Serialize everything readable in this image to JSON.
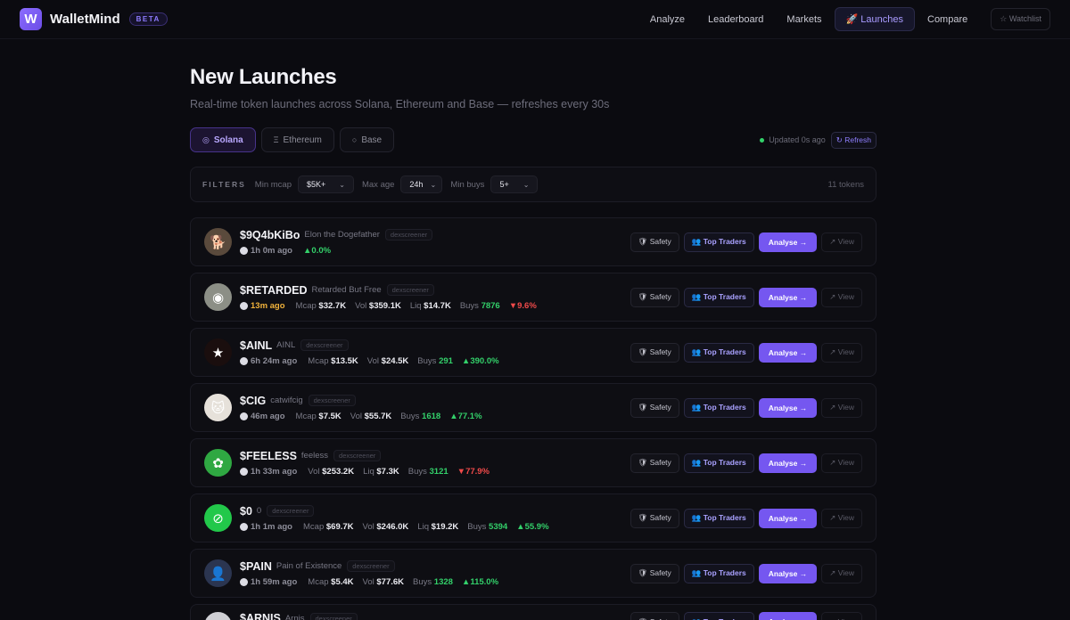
{
  "app": {
    "name": "WalletMind",
    "badge": "BETA",
    "logo_letter": "W"
  },
  "nav": {
    "items": [
      {
        "label": "Analyze"
      },
      {
        "label": "Leaderboard"
      },
      {
        "label": "Markets"
      },
      {
        "label": "🚀 Launches",
        "active": true
      },
      {
        "label": "Compare"
      }
    ],
    "watchlist": "☆ Watchlist"
  },
  "page": {
    "title": "New Launches",
    "subtitle": "Real-time token launches across Solana, Ethereum and Base — refreshes every 30s"
  },
  "chains": [
    {
      "label": "Solana",
      "glyph": "◎",
      "active": true
    },
    {
      "label": "Ethereum",
      "glyph": "Ξ",
      "active": false
    },
    {
      "label": "Base",
      "glyph": "○",
      "active": false
    }
  ],
  "status": {
    "updated": "Updated 0s ago",
    "refresh": "↻ Refresh"
  },
  "filters": {
    "title": "FILTERS",
    "min_mcap": {
      "label": "Min mcap",
      "value": "$5K+"
    },
    "max_age": {
      "label": "Max age",
      "value": "24h"
    },
    "min_buys": {
      "label": "Min buys",
      "value": "5+"
    },
    "count": "11 tokens"
  },
  "actions": {
    "safety": "🛡 Safety",
    "top_traders": "👥 Top Traders",
    "analyse": "Analyse →",
    "view": "↗ View"
  },
  "tokens": [
    {
      "symbol": "$9Q4bKiBo",
      "name": "Elon the Dogefather",
      "dex": "dexscreener",
      "age": "1h 0m ago",
      "fresh": false,
      "mcap": "",
      "vol": "",
      "liq": "",
      "buys": "",
      "change": "0.0%",
      "dir": "up",
      "avatar_color": "#5a4a3c",
      "avatar_glyph": "🐕"
    },
    {
      "symbol": "$RETARDED",
      "name": "Retarded But Free",
      "dex": "dexscreener",
      "age": "13m ago",
      "fresh": true,
      "mcap": "$32.7K",
      "vol": "$359.1K",
      "liq": "$14.7K",
      "buys": "7876",
      "change": "9.6%",
      "dir": "down",
      "avatar_color": "#8c8f86",
      "avatar_glyph": "◉"
    },
    {
      "symbol": "$AINL",
      "name": "AINL",
      "dex": "dexscreener",
      "age": "6h 24m ago",
      "fresh": false,
      "mcap": "$13.5K",
      "vol": "$24.5K",
      "liq": "",
      "buys": "291",
      "change": "390.0%",
      "dir": "up",
      "avatar_color": "#1a0e0e",
      "avatar_glyph": "★"
    },
    {
      "symbol": "$CIG",
      "name": "catwifcig",
      "dex": "dexscreener",
      "age": "46m ago",
      "fresh": false,
      "mcap": "$7.5K",
      "vol": "$55.7K",
      "liq": "",
      "buys": "1618",
      "change": "77.1%",
      "dir": "up",
      "avatar_color": "#e6e1da",
      "avatar_glyph": "🐱"
    },
    {
      "symbol": "$FEELESS",
      "name": "feeless",
      "dex": "dexscreener",
      "age": "1h 33m ago",
      "fresh": false,
      "mcap": "",
      "vol": "$253.2K",
      "liq": "$7.3K",
      "buys": "3121",
      "change": "77.9%",
      "dir": "down",
      "avatar_color": "#2fa842",
      "avatar_glyph": "✿"
    },
    {
      "symbol": "$0",
      "name": "0",
      "dex": "dexscreener",
      "age": "1h 1m ago",
      "fresh": false,
      "mcap": "$69.7K",
      "vol": "$246.0K",
      "liq": "$19.2K",
      "buys": "5394",
      "change": "55.9%",
      "dir": "up",
      "avatar_color": "#22c84a",
      "avatar_glyph": "⊘"
    },
    {
      "symbol": "$PAIN",
      "name": "Pain of Existence",
      "dex": "dexscreener",
      "age": "1h 59m ago",
      "fresh": false,
      "mcap": "$5.4K",
      "vol": "$77.6K",
      "liq": "",
      "buys": "1328",
      "change": "115.0%",
      "dir": "up",
      "avatar_color": "#2b3550",
      "avatar_glyph": "👤"
    },
    {
      "symbol": "$ARNIS",
      "name": "Arnis",
      "dex": "dexscreener",
      "age": "",
      "fresh": false,
      "mcap": "",
      "vol": "",
      "liq": "",
      "buys": "",
      "change": "",
      "dir": "up",
      "avatar_color": "#cfcfd4",
      "avatar_glyph": ""
    }
  ],
  "labels": {
    "mcap": "Mcap",
    "vol": "Vol",
    "liq": "Liq",
    "buys": "Buys"
  },
  "colors": {
    "accent": "#7557f0",
    "positive": "#33d06a",
    "negative": "#f04a4a",
    "fresh": "#f1b23b"
  }
}
